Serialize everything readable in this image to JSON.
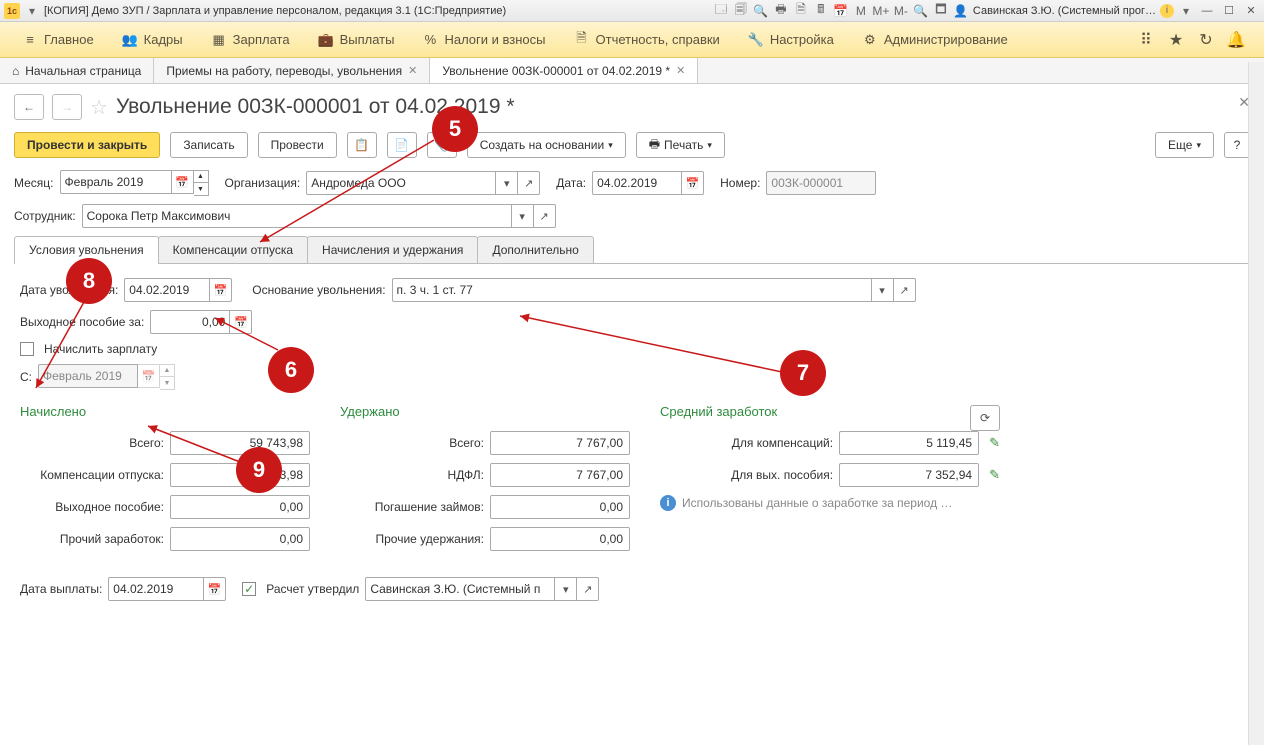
{
  "titlebar": {
    "title": "[КОПИЯ] Демо ЗУП / Зарплата и управление персоналом, редакция 3.1  (1С:Предприятие)",
    "user": "Савинская З.Ю. (Системный прог…",
    "m": "M",
    "mplus": "M+",
    "mminus": "M-"
  },
  "menu": {
    "items": [
      {
        "icon": "≡",
        "label": "Главное"
      },
      {
        "icon": "👥",
        "label": "Кадры"
      },
      {
        "icon": "▦",
        "label": "Зарплата"
      },
      {
        "icon": "💼",
        "label": "Выплаты"
      },
      {
        "icon": "%",
        "label": "Налоги и взносы"
      },
      {
        "icon": "🗎",
        "label": "Отчетность, справки"
      },
      {
        "icon": "🔧",
        "label": "Настройка"
      },
      {
        "icon": "⚙",
        "label": "Администрирование"
      }
    ]
  },
  "tabs_top": [
    {
      "icon": "⌂",
      "label": "Начальная страница"
    },
    {
      "label": "Приемы на работу, переводы, увольнения",
      "close": true
    },
    {
      "label": "Увольнение 00ЗК-000001 от 04.02.2019 *",
      "close": true,
      "active": true
    }
  ],
  "page": {
    "title": "Увольнение 00ЗК-000001 от 04.02.2019 *"
  },
  "toolbar": {
    "post_close": "Провести и закрыть",
    "save": "Записать",
    "post": "Провести",
    "create_based": "Создать на основании",
    "print": "Печать",
    "more": "Еще",
    "help": "?"
  },
  "header": {
    "month_lbl": "Месяц:",
    "month": "Февраль 2019",
    "org_lbl": "Организация:",
    "org": "Андромеда ООО",
    "date_lbl": "Дата:",
    "date": "04.02.2019",
    "num_lbl": "Номер:",
    "num": "00ЗК-000001",
    "emp_lbl": "Сотрудник:",
    "emp": "Сорока Петр Максимович"
  },
  "doc_tabs": [
    "Условия увольнения",
    "Компенсации отпуска",
    "Начисления и удержания",
    "Дополнительно"
  ],
  "form": {
    "fire_date_lbl": "Дата увольнения:",
    "fire_date": "04.02.2019",
    "reason_lbl": "Основание увольнения:",
    "reason": "п. 3 ч. 1 ст. 77",
    "severance_lbl": "Выходное пособие за:",
    "severance": "0,00",
    "charge_salary": "Начислить зарплату",
    "from_lbl": "С:",
    "from": "Февраль 2019"
  },
  "totals": {
    "accrued": {
      "head": "Начислено",
      "total_lbl": "Всего:",
      "total": "59 743,98",
      "vac_lbl": "Компенсации отпуска:",
      "vac": "59 743,98",
      "sev_lbl": "Выходное пособие:",
      "sev": "0,00",
      "other_lbl": "Прочий заработок:",
      "other": "0,00"
    },
    "withheld": {
      "head": "Удержано",
      "total_lbl": "Всего:",
      "total": "7 767,00",
      "ndfl_lbl": "НДФЛ:",
      "ndfl": "7 767,00",
      "loan_lbl": "Погашение займов:",
      "loan": "0,00",
      "other_lbl": "Прочие удержания:",
      "other": "0,00"
    },
    "avg": {
      "head": "Средний заработок",
      "comp_lbl": "Для компенсаций:",
      "comp": "5 119,45",
      "sev_lbl": "Для вых. пособия:",
      "sev": "7 352,94",
      "info": "Использованы данные о заработке за период …"
    }
  },
  "footer": {
    "pay_date_lbl": "Дата выплаты:",
    "pay_date": "04.02.2019",
    "approved": "Расчет утвердил",
    "approver": "Савинская З.Ю. (Системный п"
  },
  "markers": {
    "5": "5",
    "6": "6",
    "7": "7",
    "8": "8",
    "9": "9"
  }
}
